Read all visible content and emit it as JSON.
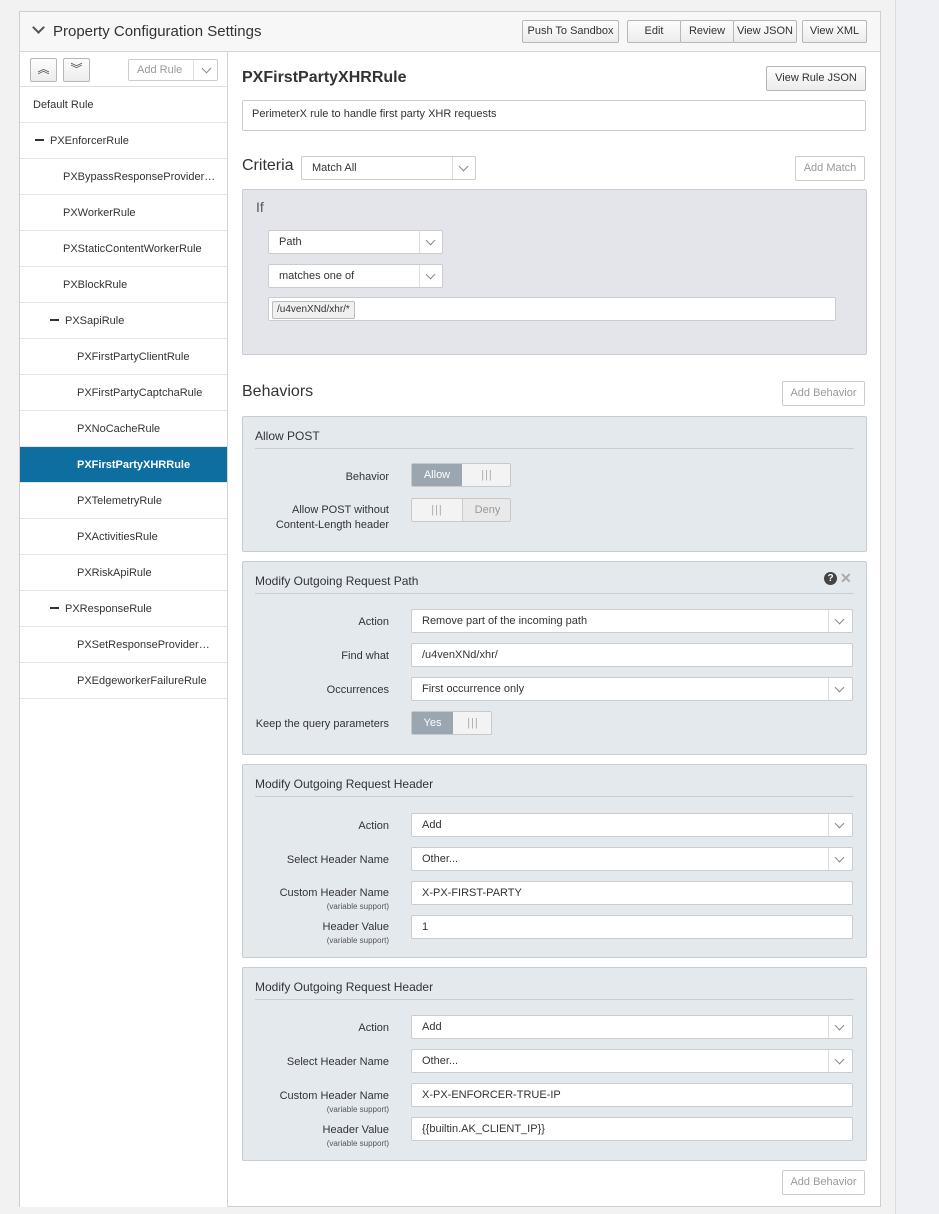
{
  "header": {
    "title": "Property Configuration Settings",
    "push_label": "Push To Sandbox",
    "edit_label": "Edit",
    "review_label": "Review",
    "view_json_label": "View JSON",
    "view_xml_label": "View XML"
  },
  "sidebar": {
    "collapse_all_glyph": "︽",
    "expand_all_glyph": "︾",
    "add_rule_label": "Add Rule",
    "rules": [
      {
        "label": "Default Rule",
        "level": 0,
        "toggle": false
      },
      {
        "label": "PXEnforcerRule",
        "level": 0,
        "toggle": true
      },
      {
        "label": "PXBypassResponseProviderRule",
        "level": 1,
        "toggle": false
      },
      {
        "label": "PXWorkerRule",
        "level": 1,
        "toggle": false
      },
      {
        "label": "PXStaticContentWorkerRule",
        "level": 1,
        "toggle": false
      },
      {
        "label": "PXBlockRule",
        "level": 1,
        "toggle": false
      },
      {
        "label": "PXSapiRule",
        "level": 1,
        "toggle": true
      },
      {
        "label": "PXFirstPartyClientRule",
        "level": 2,
        "toggle": false
      },
      {
        "label": "PXFirstPartyCaptchaRule",
        "level": 2,
        "toggle": false
      },
      {
        "label": "PXNoCacheRule",
        "level": 2,
        "toggle": false
      },
      {
        "label": "PXFirstPartyXHRRule",
        "level": 2,
        "toggle": false,
        "active": true
      },
      {
        "label": "PXTelemetryRule",
        "level": 2,
        "toggle": false
      },
      {
        "label": "PXActivitiesRule",
        "level": 2,
        "toggle": false
      },
      {
        "label": "PXRiskApiRule",
        "level": 2,
        "toggle": false
      },
      {
        "label": "PXResponseRule",
        "level": 1,
        "toggle": true
      },
      {
        "label": "PXSetResponseProviderRule",
        "level": 2,
        "toggle": false
      },
      {
        "label": "PXEdgeworkerFailureRule",
        "level": 2,
        "toggle": false
      }
    ]
  },
  "rule": {
    "title": "PXFirstPartyXHRRule",
    "view_rule_json_label": "View Rule JSON",
    "description": "PerimeterX rule to handle first party XHR requests"
  },
  "criteria": {
    "label": "Criteria",
    "match_mode": "Match All",
    "add_match_label": "Add Match",
    "if_label": "If",
    "field": "Path",
    "operator": "matches one of",
    "value_tag": "/u4venXNd/xhr/*"
  },
  "behaviors": {
    "label": "Behaviors",
    "add_behavior_label": "Add Behavior",
    "allow_post": {
      "title": "Allow POST",
      "behavior_label": "Behavior",
      "behavior_on": "Allow",
      "without_cl_label_1": "Allow POST without",
      "without_cl_label_2": "Content-Length header",
      "without_cl_off": "Deny"
    },
    "modify_path": {
      "title": "Modify Outgoing Request Path",
      "help_glyph": "?",
      "close_glyph": "✕",
      "action_label": "Action",
      "action_value": "Remove part of the incoming path",
      "find_label": "Find what",
      "find_value": "/u4venXNd/xhr/",
      "occ_label": "Occurrences",
      "occ_value": "First occurrence only",
      "keep_label": "Keep the query parameters",
      "keep_on": "Yes"
    },
    "header1": {
      "title": "Modify Outgoing Request Header",
      "action_label": "Action",
      "action_value": "Add",
      "select_name_label": "Select Header Name",
      "select_name_value": "Other...",
      "custom_name_label": "Custom Header Name",
      "custom_name_sub": "(variable support)",
      "custom_name_value": "X-PX-FIRST-PARTY",
      "header_value_label": "Header Value",
      "header_value_sub": "(variable support)",
      "header_value": "1"
    },
    "header2": {
      "title": "Modify Outgoing Request Header",
      "action_label": "Action",
      "action_value": "Add",
      "select_name_label": "Select Header Name",
      "select_name_value": "Other...",
      "custom_name_label": "Custom Header Name",
      "custom_name_sub": "(variable support)",
      "custom_name_value": "X-PX-ENFORCER-TRUE-IP",
      "header_value_label": "Header Value",
      "header_value_sub": "(variable support)",
      "header_value": "{{builtin.AK_CLIENT_IP}}"
    },
    "toggle_grip": "|||"
  },
  "colors": {
    "active_rule_bg": "#0e6ea0",
    "behavior_box_bg": "#e4e9ee",
    "toggle_on_bg": "#9aa6b0"
  }
}
